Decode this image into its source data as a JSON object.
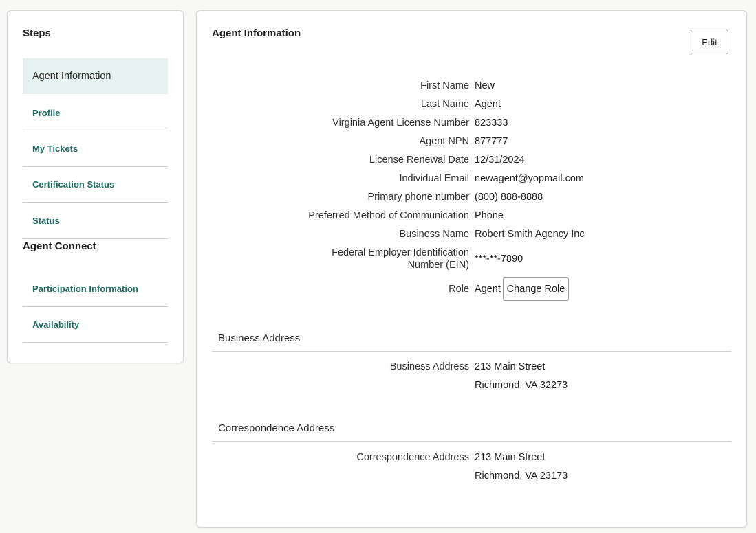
{
  "sidebar": {
    "steps_heading": "Steps",
    "steps": [
      {
        "label": "Agent Information",
        "active": true
      },
      {
        "label": "Profile",
        "active": false
      },
      {
        "label": "My Tickets",
        "active": false
      },
      {
        "label": "Certification Status",
        "active": false
      },
      {
        "label": "Status",
        "active": false
      }
    ],
    "connect_heading": "Agent Connect",
    "connect_items": [
      {
        "label": "Participation Information"
      },
      {
        "label": "Availability"
      }
    ]
  },
  "main": {
    "title": "Agent Information",
    "edit_label": "Edit",
    "fields": [
      {
        "label": "First Name",
        "value": "New"
      },
      {
        "label": "Last Name",
        "value": "Agent"
      },
      {
        "label": "Virginia Agent License Number",
        "value": "823333"
      },
      {
        "label": "Agent NPN",
        "value": "877777"
      },
      {
        "label": "License Renewal Date",
        "value": "12/31/2024"
      },
      {
        "label": "Individual Email",
        "value": "newagent@yopmail.com"
      },
      {
        "label": "Primary phone number",
        "value": "(800) 888-8888"
      },
      {
        "label": "Preferred Method of Communication",
        "value": "Phone"
      },
      {
        "label": "Business Name",
        "value": "Robert Smith Agency Inc"
      },
      {
        "label_line1": "Federal Employer Identification",
        "label_line2": "Number (EIN)",
        "value": "***-**-7890"
      },
      {
        "label": "Role",
        "value": "Agent"
      }
    ],
    "change_role_label": "Change Role",
    "business_address": {
      "section_title": "Business Address",
      "label": "Business Address",
      "line1": "213 Main Street",
      "line2": "Richmond, VA 32273"
    },
    "correspondence_address": {
      "section_title": "Correspondence Address",
      "label": "Correspondence Address",
      "line1": "213 Main Street",
      "line2": "Richmond, VA 23173"
    }
  },
  "colors": {
    "accent": "#1f6b63",
    "active_bg": "#e6f2f0",
    "page_bg": "#f8f8f7"
  }
}
